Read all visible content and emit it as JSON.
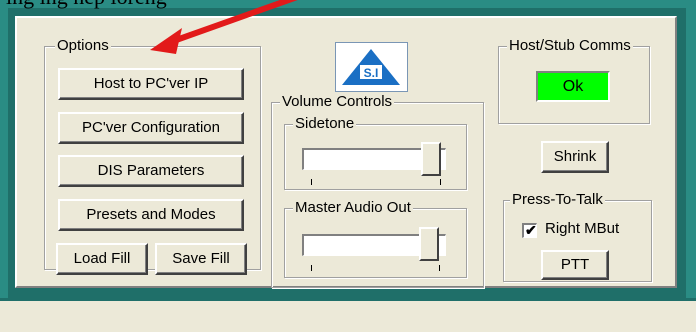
{
  "page": {
    "top_text": "ing ing   nep ioreng  "
  },
  "options": {
    "legend": "Options",
    "host_to_pcver_ip": "Host to PC'ver IP",
    "pcver_configuration": "PC'ver Configuration",
    "dis_parameters": "DIS Parameters",
    "presets_and_modes": "Presets and Modes",
    "load_fill": "Load Fill",
    "save_fill": "Save Fill"
  },
  "volume": {
    "legend": "Volume Controls",
    "sidetone_legend": "Sidetone",
    "sidetone_level": 0.9,
    "master_legend": "Master Audio Out",
    "master_level": 0.9
  },
  "comms": {
    "legend": "Host/Stub Comms",
    "status": "Ok",
    "status_color": "#00ff00"
  },
  "shrink": {
    "label": "Shrink"
  },
  "ptt": {
    "legend": "Press-To-Talk",
    "checkbox_label": "Right MBut",
    "checkbox_checked": true,
    "button_label": "PTT"
  },
  "icons": {
    "arrow": "annotation-arrow-icon",
    "logo": "company-logo-icon"
  },
  "colors": {
    "frame": "#2a8c84",
    "panel": "#ece9d8",
    "arrow": "#e21a1a",
    "logo_blue": "#1a6fc4"
  }
}
